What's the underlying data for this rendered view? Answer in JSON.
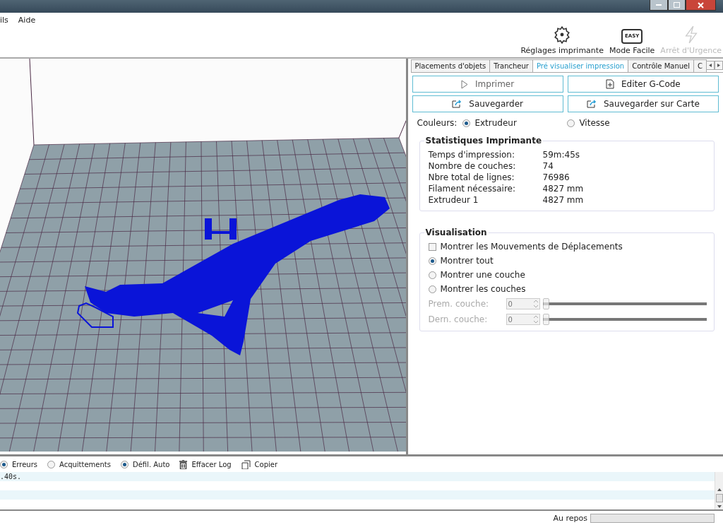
{
  "menu": [
    {
      "label": "ils"
    },
    {
      "label": "Aide"
    }
  ],
  "toolbar": [
    {
      "kind": "gear",
      "label": "Réglages imprimante",
      "disabled": false
    },
    {
      "kind": "easy",
      "label": "Mode Facile",
      "icon_text": "EASY",
      "disabled": false
    },
    {
      "kind": "bolt",
      "label": "Arrêt d'Urgence",
      "disabled": true
    }
  ],
  "tabs": [
    {
      "label": "Placements d'objets",
      "selected": false
    },
    {
      "label": "Trancheur",
      "selected": false
    },
    {
      "label": "Pré visualiser impression",
      "selected": true
    },
    {
      "label": "Contrôle Manuel",
      "selected": false
    },
    {
      "label": "C",
      "selected": false
    }
  ],
  "actions": [
    {
      "kind": "play",
      "label": "Imprimer",
      "disabled": true
    },
    {
      "kind": "edit",
      "label": "Editer G-Code",
      "disabled": false
    },
    {
      "kind": "export",
      "label": "Sauvegarder",
      "disabled": false
    },
    {
      "kind": "export",
      "label": "Sauvegarder sur Carte",
      "disabled": false
    }
  ],
  "colors": {
    "label": "Couleurs:",
    "options": [
      {
        "label": "Extrudeur",
        "selected": true
      },
      {
        "label": "Vitesse",
        "selected": false
      }
    ]
  },
  "statistics": {
    "title": "Statistiques Imprimante",
    "rows": [
      {
        "label": "Temps d'impression:",
        "value": "59m:45s"
      },
      {
        "label": "Nombre de couches:",
        "value": "74"
      },
      {
        "label": "Nbre total de lignes:",
        "value": "76986"
      },
      {
        "label": "Filament nécessaire:",
        "value": "4827 mm"
      },
      {
        "label": "Extrudeur 1",
        "value": "4827 mm"
      }
    ]
  },
  "visualisation": {
    "title": "Visualisation",
    "options": [
      {
        "kind": "checkbox",
        "label": "Montrer les Mouvements de Déplacements",
        "checked": false
      },
      {
        "kind": "radio",
        "label": "Montrer tout",
        "selected": true
      },
      {
        "kind": "radio",
        "label": "Montrer une couche",
        "selected": false
      },
      {
        "kind": "radio",
        "label": "Montrer les couches",
        "selected": false
      }
    ],
    "layers": [
      {
        "label": "Prem. couche:",
        "value": "0",
        "level": 0,
        "disabled": true
      },
      {
        "label": "Dern. couche:",
        "value": "0",
        "level": 0,
        "disabled": true
      }
    ]
  },
  "log": {
    "filters": [
      {
        "kind": "radio",
        "label": "Erreurs",
        "selected": true
      },
      {
        "kind": "radio",
        "label": "Acquittements",
        "selected": false
      },
      {
        "kind": "radio",
        "label": "Défil. Auto",
        "selected": true
      },
      {
        "kind": "trash",
        "label": "Effacer Log"
      },
      {
        "kind": "copy",
        "label": "Copier"
      }
    ],
    "lines": [
      ".40s."
    ]
  },
  "status": {
    "text": "Au repos",
    "level": 0
  }
}
